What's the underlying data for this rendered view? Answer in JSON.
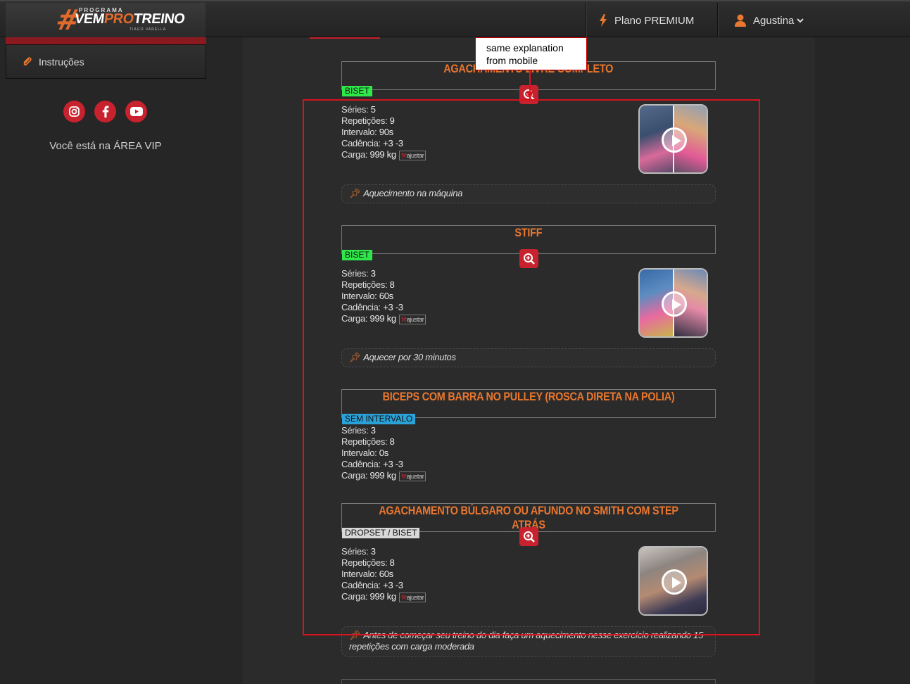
{
  "logo": {
    "small": "PROGRAMA",
    "main_a": "VEM",
    "main_b": "PRO",
    "main_c": "TREINO",
    "sub": "TIAGO VARELLA"
  },
  "header": {
    "plan_label": "Plano PREMIUM",
    "user_name": "Agustina"
  },
  "sidebar": {
    "item_label": "Instruções",
    "vip_text": "Você está na ÁREA VIP"
  },
  "exercises": [
    {
      "title": "AGACHAMENTO LIVRE COMPLETO",
      "tag": "BISET",
      "series": "5",
      "reps": "9",
      "interval": "90s",
      "cadence": "+3 -3",
      "load": "999 kg",
      "note": "Aquecimento na máquina"
    },
    {
      "title": "STIFF",
      "tag": "BISET",
      "series": "3",
      "reps": "8",
      "interval": "60s",
      "cadence": "+3 -3",
      "load": "999 kg",
      "note": "Aquecer por 30 minutos"
    },
    {
      "title": "BICEPS COM BARRA NO PULLEY (ROSCA DIRETA NA POLIA)",
      "tag": "SEM INTERVALO",
      "series": "3",
      "reps": "8",
      "interval": "0s",
      "cadence": "+3 -3",
      "load": "999 kg"
    },
    {
      "title": "AGACHAMENTO BÚLGARO OU AFUNDO NO SMITH COM STEP ATRÁS",
      "tag": "DROPSET / BISET",
      "series": "3",
      "reps": "8",
      "interval": "60s",
      "cadence": "+3 -3",
      "load": "999 kg",
      "note": "Antes de começar seu treino do dia faça um aquecimento nesse exercício realizando 15 repetições com carga moderada"
    }
  ],
  "labels": {
    "series": "Séries:",
    "reps": "Repetições:",
    "interval": "Intervalo:",
    "cadence": "Cadência:",
    "load": "Carga:",
    "adjust": "ajustar"
  },
  "annotation": {
    "callout": "same explanation from mobile"
  },
  "colors": {
    "accent_orange": "#e9772e",
    "brand_red": "#c8222e",
    "tag_green": "#2ee84a",
    "tag_blue": "#2aa2d8",
    "tag_gray": "#d8d8d8"
  },
  "icons": [
    "bolt-icon",
    "user-icon",
    "chevron-down-icon",
    "paperclip-icon",
    "instagram-icon",
    "facebook-icon",
    "youtube-icon",
    "zoom-in-icon",
    "play-icon",
    "pin-icon",
    "wrench-icon"
  ]
}
